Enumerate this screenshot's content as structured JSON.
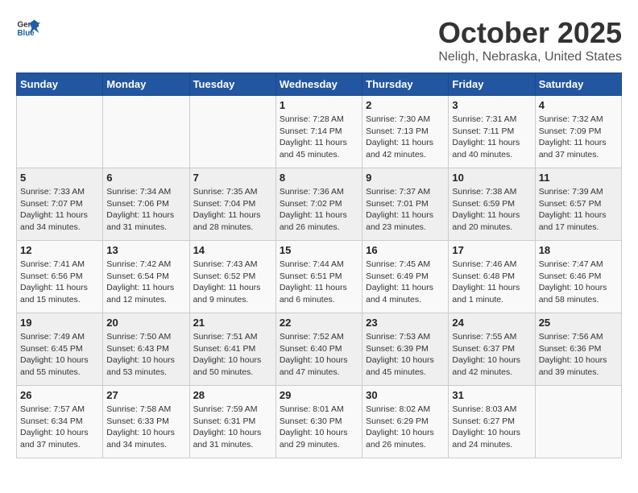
{
  "header": {
    "logo_general": "General",
    "logo_blue": "Blue",
    "month_title": "October 2025",
    "location": "Neligh, Nebraska, United States"
  },
  "days_of_week": [
    "Sunday",
    "Monday",
    "Tuesday",
    "Wednesday",
    "Thursday",
    "Friday",
    "Saturday"
  ],
  "weeks": [
    {
      "days": [
        {
          "number": "",
          "info": ""
        },
        {
          "number": "",
          "info": ""
        },
        {
          "number": "",
          "info": ""
        },
        {
          "number": "1",
          "info": "Sunrise: 7:28 AM\nSunset: 7:14 PM\nDaylight: 11 hours and 45 minutes."
        },
        {
          "number": "2",
          "info": "Sunrise: 7:30 AM\nSunset: 7:13 PM\nDaylight: 11 hours and 42 minutes."
        },
        {
          "number": "3",
          "info": "Sunrise: 7:31 AM\nSunset: 7:11 PM\nDaylight: 11 hours and 40 minutes."
        },
        {
          "number": "4",
          "info": "Sunrise: 7:32 AM\nSunset: 7:09 PM\nDaylight: 11 hours and 37 minutes."
        }
      ]
    },
    {
      "days": [
        {
          "number": "5",
          "info": "Sunrise: 7:33 AM\nSunset: 7:07 PM\nDaylight: 11 hours and 34 minutes."
        },
        {
          "number": "6",
          "info": "Sunrise: 7:34 AM\nSunset: 7:06 PM\nDaylight: 11 hours and 31 minutes."
        },
        {
          "number": "7",
          "info": "Sunrise: 7:35 AM\nSunset: 7:04 PM\nDaylight: 11 hours and 28 minutes."
        },
        {
          "number": "8",
          "info": "Sunrise: 7:36 AM\nSunset: 7:02 PM\nDaylight: 11 hours and 26 minutes."
        },
        {
          "number": "9",
          "info": "Sunrise: 7:37 AM\nSunset: 7:01 PM\nDaylight: 11 hours and 23 minutes."
        },
        {
          "number": "10",
          "info": "Sunrise: 7:38 AM\nSunset: 6:59 PM\nDaylight: 11 hours and 20 minutes."
        },
        {
          "number": "11",
          "info": "Sunrise: 7:39 AM\nSunset: 6:57 PM\nDaylight: 11 hours and 17 minutes."
        }
      ]
    },
    {
      "days": [
        {
          "number": "12",
          "info": "Sunrise: 7:41 AM\nSunset: 6:56 PM\nDaylight: 11 hours and 15 minutes."
        },
        {
          "number": "13",
          "info": "Sunrise: 7:42 AM\nSunset: 6:54 PM\nDaylight: 11 hours and 12 minutes."
        },
        {
          "number": "14",
          "info": "Sunrise: 7:43 AM\nSunset: 6:52 PM\nDaylight: 11 hours and 9 minutes."
        },
        {
          "number": "15",
          "info": "Sunrise: 7:44 AM\nSunset: 6:51 PM\nDaylight: 11 hours and 6 minutes."
        },
        {
          "number": "16",
          "info": "Sunrise: 7:45 AM\nSunset: 6:49 PM\nDaylight: 11 hours and 4 minutes."
        },
        {
          "number": "17",
          "info": "Sunrise: 7:46 AM\nSunset: 6:48 PM\nDaylight: 11 hours and 1 minute."
        },
        {
          "number": "18",
          "info": "Sunrise: 7:47 AM\nSunset: 6:46 PM\nDaylight: 10 hours and 58 minutes."
        }
      ]
    },
    {
      "days": [
        {
          "number": "19",
          "info": "Sunrise: 7:49 AM\nSunset: 6:45 PM\nDaylight: 10 hours and 55 minutes."
        },
        {
          "number": "20",
          "info": "Sunrise: 7:50 AM\nSunset: 6:43 PM\nDaylight: 10 hours and 53 minutes."
        },
        {
          "number": "21",
          "info": "Sunrise: 7:51 AM\nSunset: 6:41 PM\nDaylight: 10 hours and 50 minutes."
        },
        {
          "number": "22",
          "info": "Sunrise: 7:52 AM\nSunset: 6:40 PM\nDaylight: 10 hours and 47 minutes."
        },
        {
          "number": "23",
          "info": "Sunrise: 7:53 AM\nSunset: 6:39 PM\nDaylight: 10 hours and 45 minutes."
        },
        {
          "number": "24",
          "info": "Sunrise: 7:55 AM\nSunset: 6:37 PM\nDaylight: 10 hours and 42 minutes."
        },
        {
          "number": "25",
          "info": "Sunrise: 7:56 AM\nSunset: 6:36 PM\nDaylight: 10 hours and 39 minutes."
        }
      ]
    },
    {
      "days": [
        {
          "number": "26",
          "info": "Sunrise: 7:57 AM\nSunset: 6:34 PM\nDaylight: 10 hours and 37 minutes."
        },
        {
          "number": "27",
          "info": "Sunrise: 7:58 AM\nSunset: 6:33 PM\nDaylight: 10 hours and 34 minutes."
        },
        {
          "number": "28",
          "info": "Sunrise: 7:59 AM\nSunset: 6:31 PM\nDaylight: 10 hours and 31 minutes."
        },
        {
          "number": "29",
          "info": "Sunrise: 8:01 AM\nSunset: 6:30 PM\nDaylight: 10 hours and 29 minutes."
        },
        {
          "number": "30",
          "info": "Sunrise: 8:02 AM\nSunset: 6:29 PM\nDaylight: 10 hours and 26 minutes."
        },
        {
          "number": "31",
          "info": "Sunrise: 8:03 AM\nSunset: 6:27 PM\nDaylight: 10 hours and 24 minutes."
        },
        {
          "number": "",
          "info": ""
        }
      ]
    }
  ]
}
